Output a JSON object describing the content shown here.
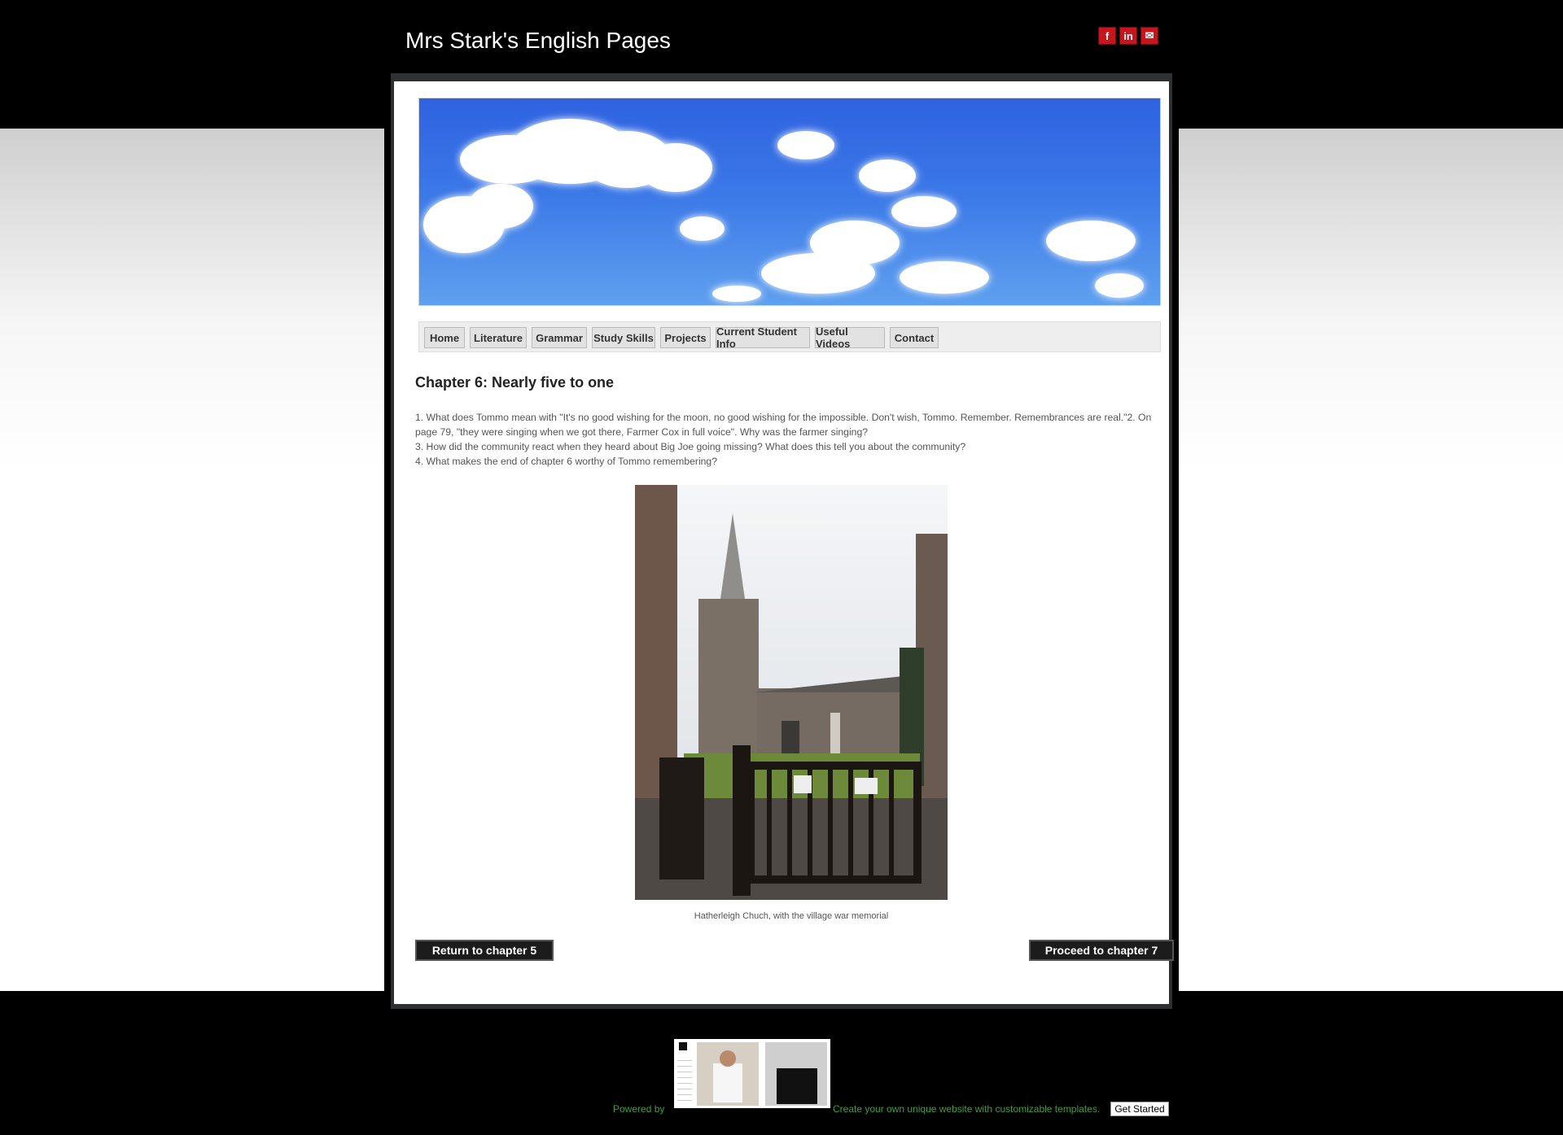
{
  "site": {
    "title": "Mrs Stark's English Pages",
    "social": [
      {
        "icon": "facebook-icon",
        "glyph": "f"
      },
      {
        "icon": "linkedin-icon",
        "glyph": "in"
      },
      {
        "icon": "email-icon",
        "glyph": "✉"
      }
    ]
  },
  "nav": {
    "items": [
      "Home",
      "Literature",
      "Grammar",
      "Study Skills",
      "Projects",
      "Current Student Info",
      "Useful Videos",
      "Contact"
    ]
  },
  "page": {
    "heading": "Chapter 6: Nearly five to one",
    "questions": [
      "1. What does Tommo mean with \"It's no good wishing for the moon, no good wishing for the impossible. Don't wish, Tommo. Remember. Remembrances are real.\"2. On page 79, \"they were singing when we got there, Farmer Cox in full voice\". Why was the farmer singing?",
      "3. How did the community react when they heard about Big Joe going missing? What does this tell you about the community?",
      "4. What makes the end of chapter 6 worthy of Tommo remembering?"
    ],
    "image_caption": "Hatherleigh Chuch, with the village war memorial",
    "prev_button": "Return to chapter 5",
    "next_button": "Proceed to chapter 7"
  },
  "footer": {
    "powered_by": "Powered by",
    "promo": "Create your own unique website with customizable templates.",
    "cta": "Get Started"
  },
  "colors": {
    "accent_red": "#c7151d",
    "page_bg": "#000000",
    "footer_link": "#3aa13a"
  }
}
